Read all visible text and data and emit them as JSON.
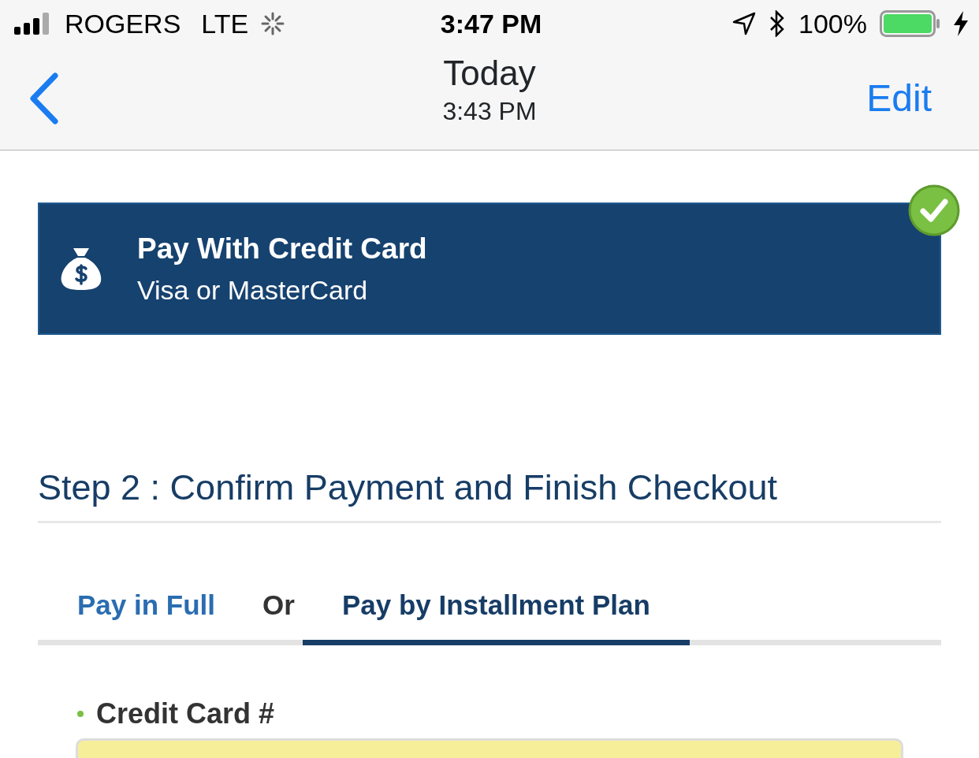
{
  "status_bar": {
    "carrier": "ROGERS",
    "network": "LTE",
    "time": "3:47 PM",
    "battery": "100%"
  },
  "nav_bar": {
    "title": "Today",
    "subtitle": "3:43 PM",
    "action": "Edit"
  },
  "payment_option": {
    "title": "Pay With Credit Card",
    "subtitle": "Visa or MasterCard",
    "selected": true
  },
  "step_heading": "Step 2 : Confirm Payment and Finish Checkout",
  "tabs": [
    {
      "label": "Pay in Full",
      "selected": false
    },
    {
      "label": "Pay by Installment Plan",
      "selected": true
    }
  ],
  "tab_separator": "Or",
  "credit_card_field": {
    "label": "Credit Card #"
  }
}
